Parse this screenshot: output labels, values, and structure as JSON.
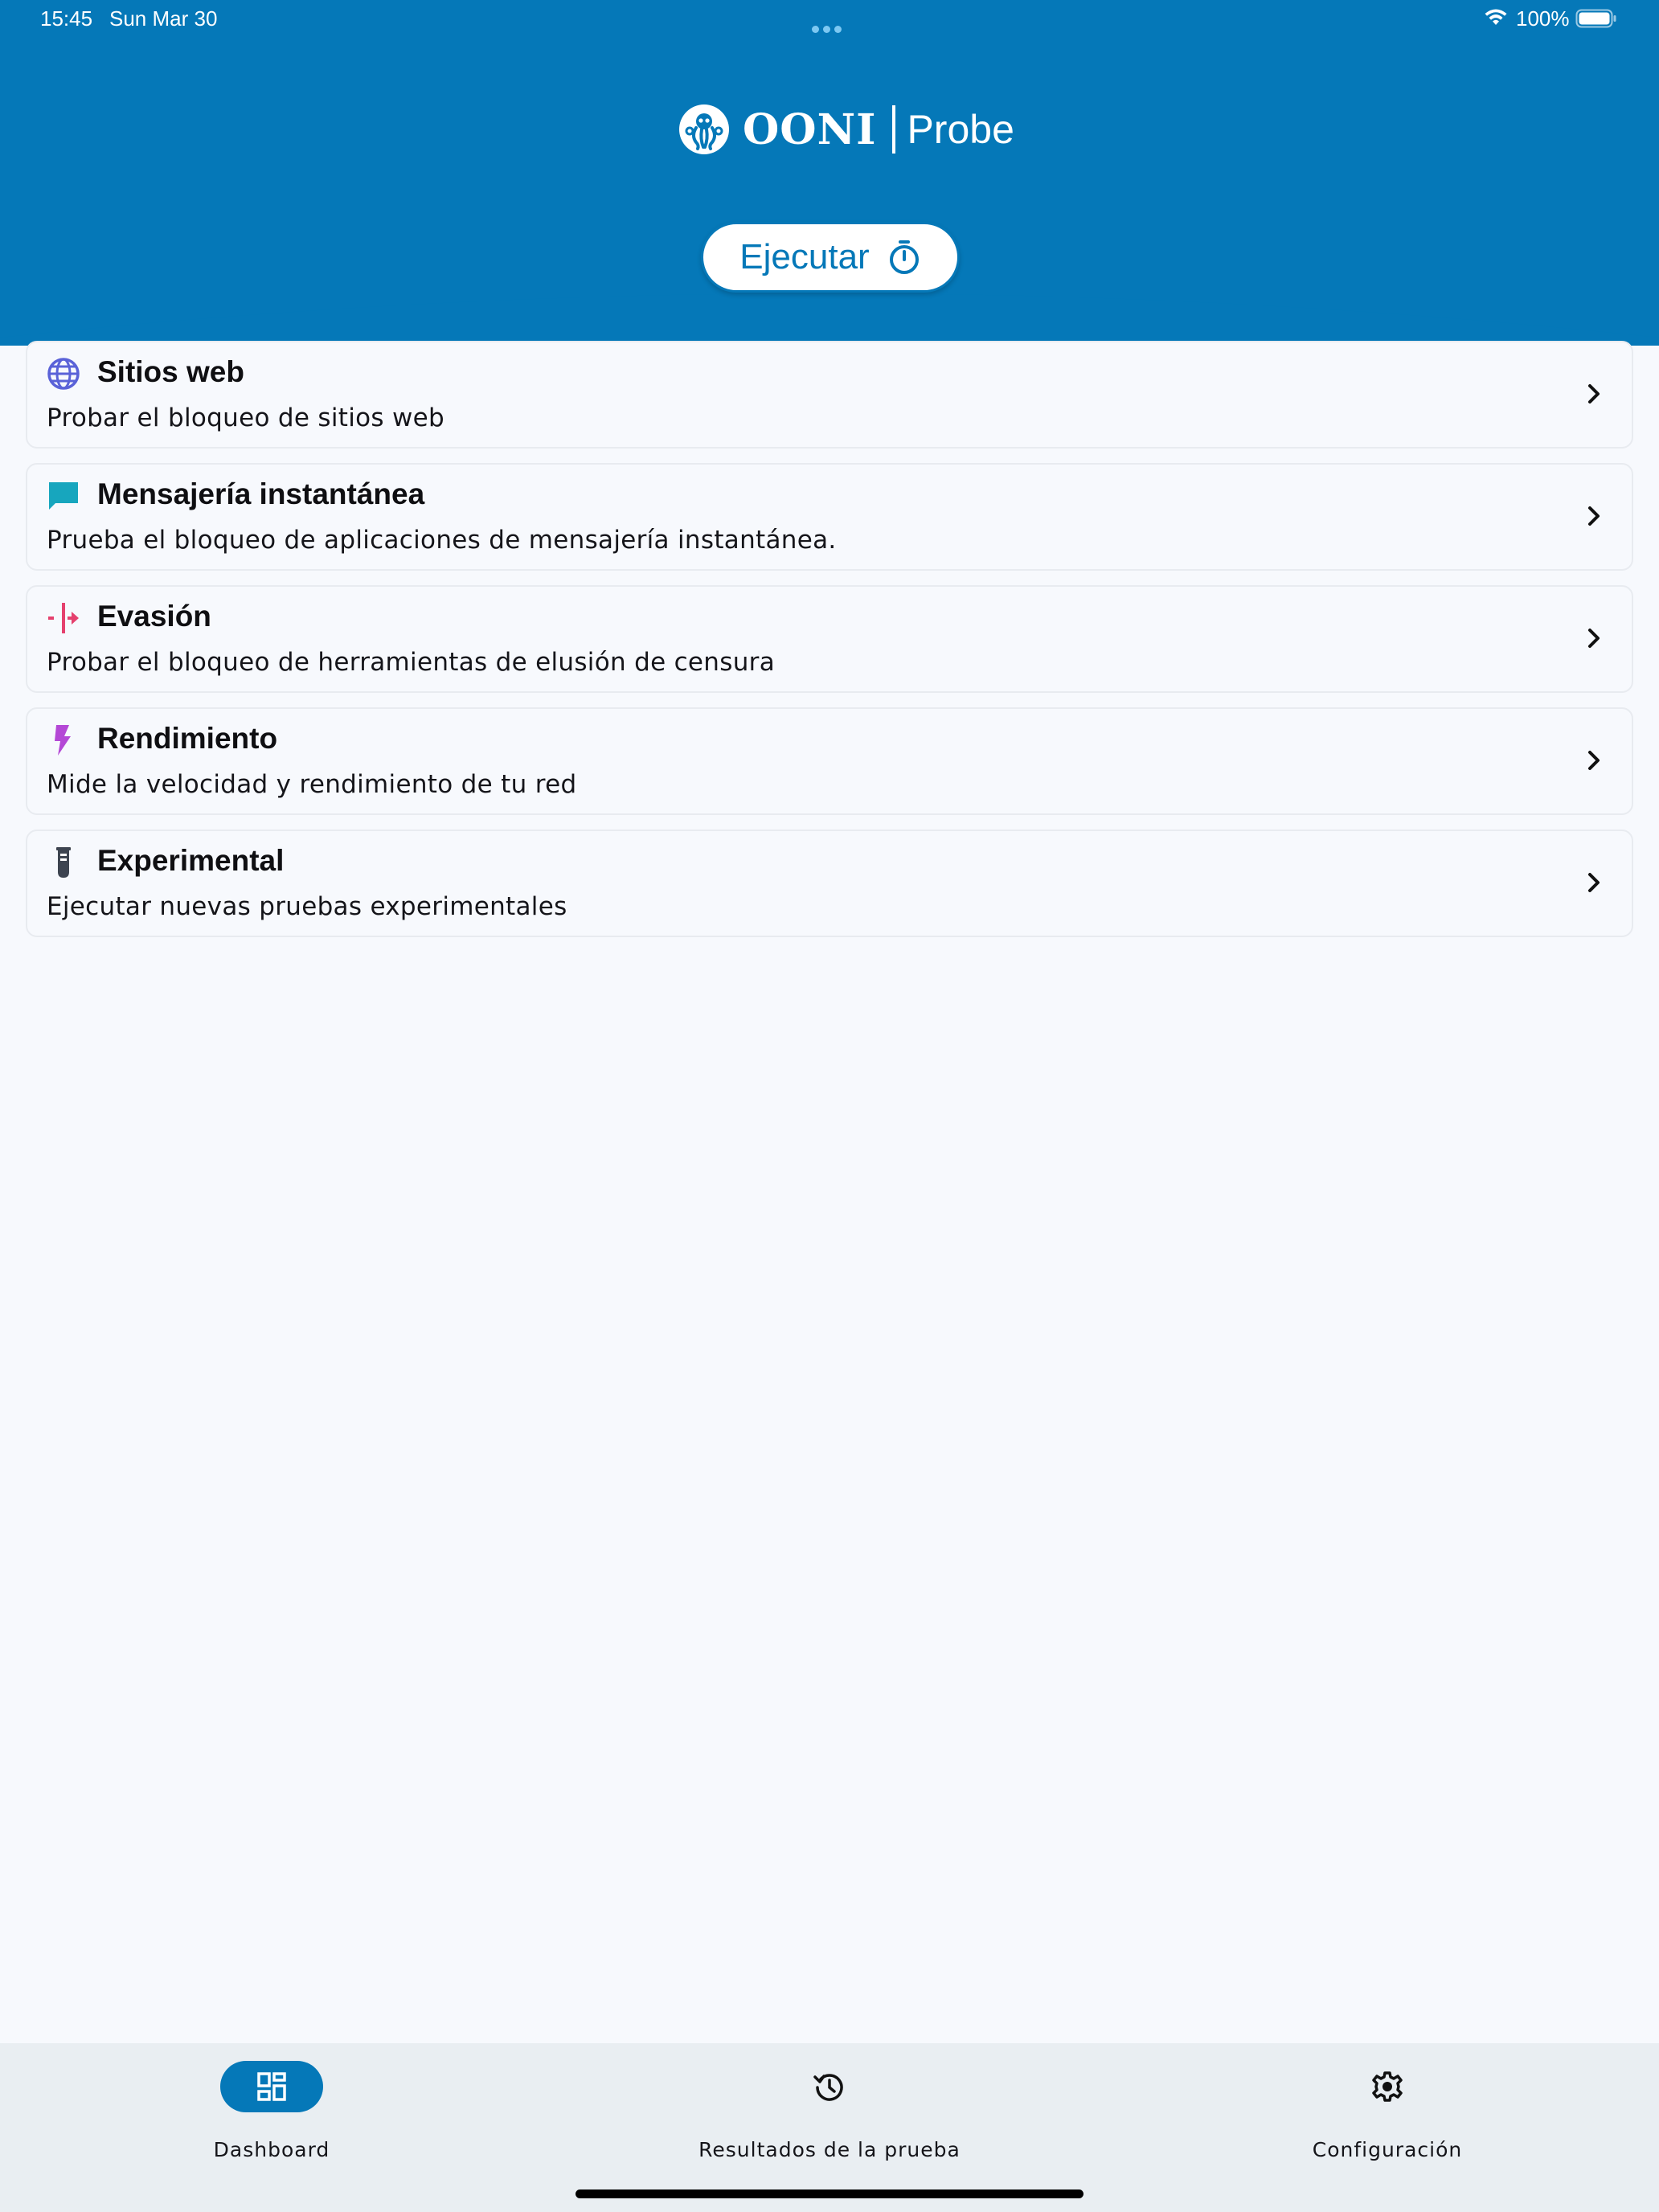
{
  "status_bar": {
    "time": "15:45",
    "date": "Sun Mar 30",
    "battery": "100%"
  },
  "header": {
    "logo_name": "OONI",
    "logo_product": "Probe",
    "run_button_label": "Ejecutar",
    "color": "#0578b8"
  },
  "cards": [
    {
      "title": "Sitios web",
      "description": "Probar el bloqueo de sitios web",
      "icon": "globe-icon",
      "icon_color": "#5a62d8"
    },
    {
      "title": "Mensajería instantánea",
      "description": "Prueba el bloqueo de aplicaciones de mensajería instantánea.",
      "icon": "chat-bubble-icon",
      "icon_color": "#17a6be"
    },
    {
      "title": "Evasión",
      "description": "Probar el bloqueo de herramientas de elusión de censura",
      "icon": "circumvention-icon",
      "icon_color": "#e5416e"
    },
    {
      "title": "Rendimiento",
      "description": "Mide la velocidad y rendimiento de tu red",
      "icon": "lightning-icon",
      "icon_color": "#b448d6"
    },
    {
      "title": "Experimental",
      "description": "Ejecutar nuevas pruebas experimentales",
      "icon": "flask-icon",
      "icon_color": "#3d4450"
    }
  ],
  "bottom_nav": {
    "items": [
      {
        "label": "Dashboard",
        "icon": "dashboard-icon",
        "active": true
      },
      {
        "label": "Resultados de la prueba",
        "icon": "history-icon",
        "active": false
      },
      {
        "label": "Configuración",
        "icon": "gear-icon",
        "active": false
      }
    ]
  }
}
